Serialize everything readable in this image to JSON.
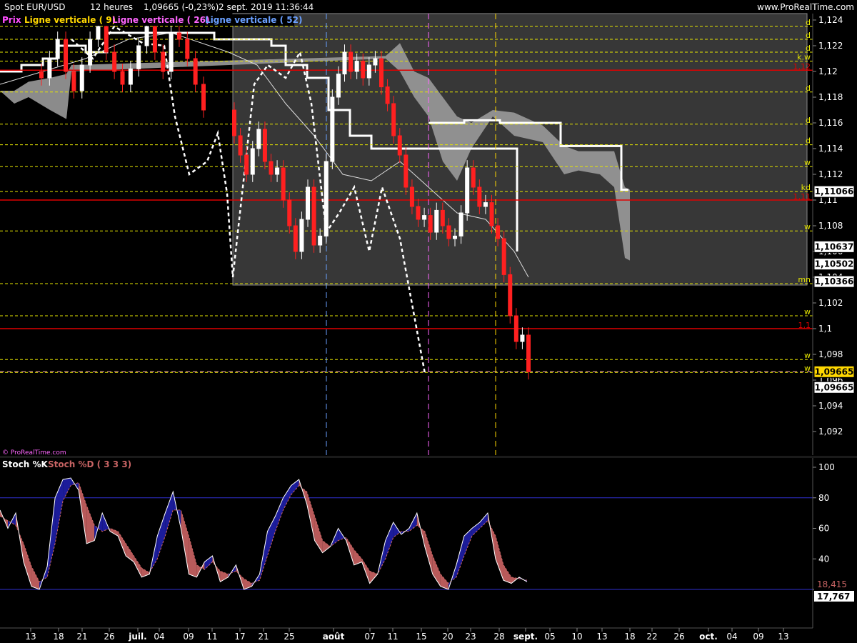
{
  "header": {
    "instrument": "Spot EUR/USD",
    "timeframe": "12 heures",
    "price_change": "1,09665 (-0,23%)",
    "datetime": "2 sept. 2019 11:36:44",
    "site": "www.ProRealTime.com"
  },
  "legend": {
    "price": "Prix",
    "vline1": "Ligne verticale ( 9)",
    "vline2": "Ligne verticale ( 26)",
    "vline3": "Ligne verticale ( 52)"
  },
  "watermark": "© ProRealTime.com",
  "colors": {
    "background": "#000000",
    "candle_up": "#ffffff",
    "candle_down": "#ff2020",
    "level_dashed": "#e6e600",
    "level_red": "#e00000",
    "cloud": "#9a9a9a",
    "box": "#5a5a5a",
    "stoch_k": "#ffffff",
    "stoch_d": "#c86464",
    "vline9": "#ffd700",
    "vline26": "#ff66ff",
    "vline52": "#6aa0ff"
  },
  "price_axis": {
    "ticks": [
      "1,124",
      "1,122",
      "1,12",
      "1,118",
      "1,116",
      "1,114",
      "1,112",
      "1,11",
      "1,108",
      "1,106",
      "1,104",
      "1,102",
      "1,1",
      "1,098",
      "1,096",
      "1,094",
      "1,092"
    ],
    "badges": [
      {
        "label": "1,11066",
        "style": "white"
      },
      {
        "label": "1,10637",
        "style": "white"
      },
      {
        "label": "1,10502",
        "style": "white"
      },
      {
        "label": "1,10366",
        "style": "white"
      },
      {
        "label": "1,09665",
        "style": "yellow"
      },
      {
        "label": "1,09665",
        "style": "white"
      }
    ]
  },
  "level_labels": [
    {
      "tag": "d",
      "price": 1.1235
    },
    {
      "tag": "d",
      "price": 1.1225
    },
    {
      "tag": "d",
      "price": 1.1215
    },
    {
      "tag": "k.w",
      "price": 1.1208
    },
    {
      "tag": "d",
      "price": 1.1184
    },
    {
      "tag": "d",
      "price": 1.1159
    },
    {
      "tag": "d",
      "price": 1.1143
    },
    {
      "tag": "w",
      "price": 1.1126
    },
    {
      "tag": "kd",
      "price": 1.11066
    },
    {
      "tag": "w",
      "price": 1.1076
    },
    {
      "tag": "mn",
      "price": 1.1035
    },
    {
      "tag": "w",
      "price": 1.101
    },
    {
      "tag": "w",
      "price": 1.0976
    },
    {
      "tag": "w",
      "price": 1.0966
    }
  ],
  "red_level_labels": [
    {
      "label": "1,12",
      "price": 1.1201
    },
    {
      "label": "1,11",
      "price": 1.11
    },
    {
      "label": "1,1",
      "price": 1.1
    }
  ],
  "stoch": {
    "title_k": "Stoch %K",
    "title_d": "Stoch %D ( 3 3 3)",
    "ticks": [
      "100",
      "80",
      "60",
      "40",
      "20"
    ],
    "badge_d": "18,415",
    "badge_k": "17,767"
  },
  "x_axis": {
    "labels": [
      "13",
      "18",
      "21",
      "26",
      "juil.",
      "04",
      "09",
      "11",
      "17",
      "21",
      "25",
      "août",
      "07",
      "11",
      "15",
      "20",
      "23",
      "28",
      "sept.",
      "05",
      "10",
      "13",
      "18",
      "22",
      "26",
      "oct.",
      "04",
      "09",
      "13"
    ]
  },
  "chart_data": [
    {
      "type": "candlestick",
      "title": "Spot EUR/USD",
      "series": [
        {
          "name": "Prix",
          "close": [
            1.1195,
            1.121,
            1.1225,
            1.12,
            1.1185,
            1.1205,
            1.1225,
            1.1235,
            1.1215,
            1.12,
            1.119,
            1.1202,
            1.122,
            1.1235,
            1.1215,
            1.12,
            1.123,
            1.1225,
            1.121,
            1.119,
            1.117,
            1.115,
            1.1135,
            1.112,
            1.114,
            1.1155,
            1.113,
            1.112,
            1.1125,
            1.11,
            1.108,
            1.106,
            1.1085,
            1.111,
            1.1065,
            1.1072,
            1.113,
            1.118,
            1.1198,
            1.1215,
            1.12,
            1.1208,
            1.1195,
            1.1205,
            1.121,
            1.1188,
            1.1175,
            1.115,
            1.1135,
            1.111,
            1.1095,
            1.1085,
            1.1088,
            1.1075,
            1.1092,
            1.108,
            1.107,
            1.1072,
            1.109,
            1.1125,
            1.111,
            1.1095,
            1.1098,
            1.108,
            1.107,
            1.1042,
            1.101,
            1.099,
            1.0995,
            1.09665
          ]
        }
      ],
      "ylim": [
        1.091,
        1.125
      ],
      "y_ticks": [
        1.124,
        1.122,
        1.12,
        1.118,
        1.116,
        1.114,
        1.112,
        1.11,
        1.108,
        1.106,
        1.104,
        1.102,
        1.1,
        1.098,
        1.096,
        1.094,
        1.092
      ]
    },
    {
      "type": "line",
      "title": "Stoch %K",
      "series": [
        {
          "name": "Stoch %K",
          "values": [
            72,
            60,
            70,
            38,
            22,
            20,
            35,
            80,
            92,
            93,
            85,
            50,
            52,
            70,
            58,
            55,
            42,
            38,
            28,
            30,
            55,
            70,
            84,
            60,
            30,
            28,
            38,
            42,
            25,
            28,
            36,
            20,
            22,
            30,
            58,
            68,
            80,
            88,
            92,
            76,
            52,
            44,
            48,
            60,
            52,
            36,
            38,
            24,
            30,
            52,
            64,
            56,
            60,
            70,
            48,
            30,
            22,
            20,
            36,
            55,
            60,
            64,
            70,
            40,
            26,
            24,
            28,
            25
          ]
        },
        {
          "name": "Stoch %D ( 3 3 3)",
          "values": [
            68,
            65,
            62,
            50,
            35,
            25,
            28,
            50,
            78,
            88,
            90,
            75,
            62,
            58,
            60,
            58,
            50,
            42,
            34,
            31,
            40,
            55,
            72,
            72,
            55,
            36,
            33,
            38,
            32,
            30,
            32,
            27,
            24,
            26,
            42,
            58,
            72,
            82,
            88,
            84,
            68,
            52,
            48,
            52,
            54,
            46,
            40,
            32,
            30,
            40,
            54,
            58,
            58,
            62,
            58,
            42,
            30,
            24,
            28,
            42,
            55,
            60,
            65,
            55,
            36,
            28,
            27,
            26
          ]
        }
      ],
      "ylim": [
        0,
        110
      ],
      "reference_lines": [
        80,
        20
      ]
    }
  ]
}
